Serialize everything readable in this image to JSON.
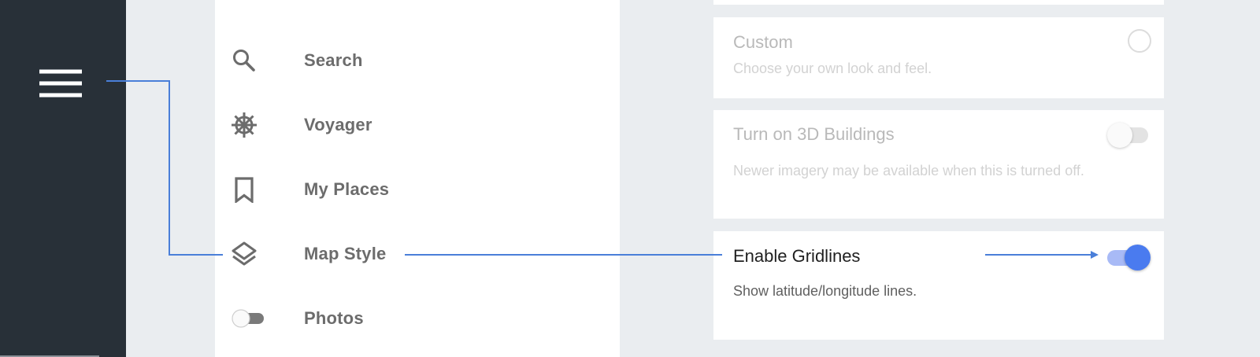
{
  "sidebar": {
    "menu_icon": "hamburger-menu-icon"
  },
  "nav": {
    "items": [
      {
        "label": "Search",
        "icon": "search-icon"
      },
      {
        "label": "Voyager",
        "icon": "ship-wheel-icon"
      },
      {
        "label": "My Places",
        "icon": "bookmark-icon"
      },
      {
        "label": "Map Style",
        "icon": "layers-icon"
      },
      {
        "label": "Photos",
        "icon": "toggle-switch-icon"
      }
    ]
  },
  "settings": {
    "custom": {
      "title": "Custom",
      "description": "Choose your own look and feel.",
      "selected": false
    },
    "buildings_3d": {
      "title": "Turn on 3D Buildings",
      "description": "Newer imagery may be available when this is turned off.",
      "enabled": false
    },
    "gridlines": {
      "title": "Enable Gridlines",
      "description": "Show latitude/longitude lines.",
      "enabled": true
    }
  },
  "colors": {
    "rail": "#283038",
    "page": "#eaedf0",
    "accent": "#4a7bef",
    "callout": "#4a7fd9"
  }
}
